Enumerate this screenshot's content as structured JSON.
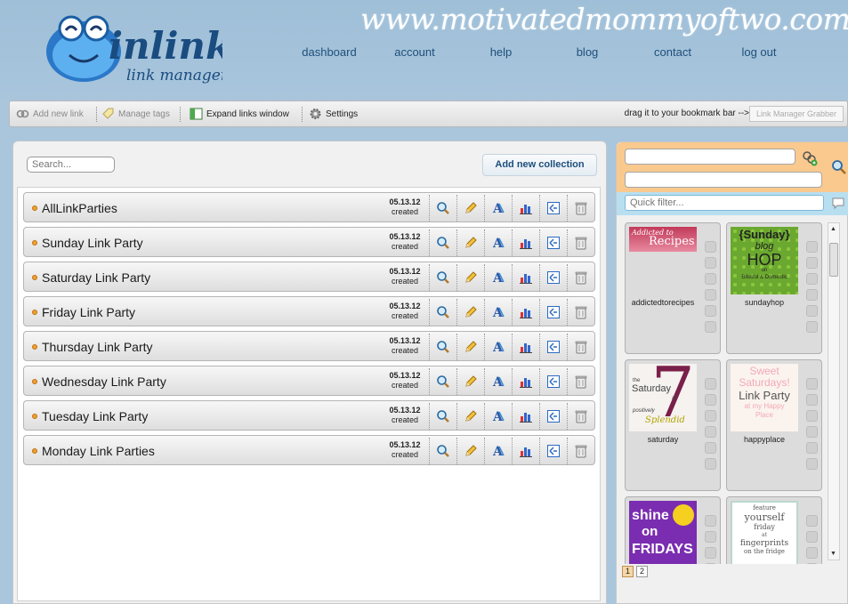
{
  "header": {
    "site_url": "www.motivatedmommyoftwo.com",
    "logo_title": "inlinkz",
    "logo_subtitle": "link manager",
    "nav": [
      "dashboard",
      "account",
      "help",
      "blog",
      "contact",
      "log out"
    ]
  },
  "toolbar": {
    "add_new_link": "Add new link",
    "manage_tags": "Manage tags",
    "expand_links_window": "Expand links window",
    "settings": "Settings",
    "drag_hint": "drag it to your bookmark bar -->",
    "grabber": "Link Manager Grabber"
  },
  "main": {
    "search_placeholder": "Search...",
    "add_collection": "Add new collection",
    "created_label": "created",
    "collections": [
      {
        "name": "AllLinkParties",
        "date": "05.13.12"
      },
      {
        "name": "Sunday Link Party",
        "date": "05.13.12"
      },
      {
        "name": "Saturday Link Party",
        "date": "05.13.12"
      },
      {
        "name": "Friday Link Party",
        "date": "05.13.12"
      },
      {
        "name": "Thursday Link Party",
        "date": "05.13.12"
      },
      {
        "name": "Wednesday Link Party",
        "date": "05.13.12"
      },
      {
        "name": "Tuesday Link Party",
        "date": "05.13.12"
      },
      {
        "name": "Monday Link Parties",
        "date": "05.13.12"
      }
    ]
  },
  "right": {
    "quick_filter_placeholder": "Quick filter...",
    "cards": [
      {
        "caption": "addictedtorecipes",
        "thumb": {
          "line1": "Addicted to",
          "line2": "Recipes"
        }
      },
      {
        "caption": "sundayhop",
        "thumb": {
          "line1": "{Sunday}",
          "line2": "blog",
          "line3": "HOP",
          "line4": "on",
          "line5": "Blissful & Domestic"
        }
      },
      {
        "caption": "saturday",
        "thumb": {
          "line1": "the",
          "line2": "Saturday",
          "line3": "at",
          "line4": "positively",
          "line5": "Splendid",
          "big": "7"
        }
      },
      {
        "caption": "happyplace",
        "thumb": {
          "line1": "Sweet",
          "line2": "Saturdays!",
          "line3": "Link Party",
          "line4": "at my Happy",
          "line5": "Place"
        }
      },
      {
        "caption": "",
        "thumb": {
          "line1": "shine",
          "line2": "on",
          "line3": "FRIDAYS"
        }
      },
      {
        "caption": "",
        "thumb": {
          "line1": "feature",
          "line2": "yourself",
          "line3": "friday",
          "line4": "at",
          "line5": "fingerprints",
          "line6": "on the fridge"
        }
      }
    ],
    "pages": [
      "1",
      "2"
    ]
  }
}
